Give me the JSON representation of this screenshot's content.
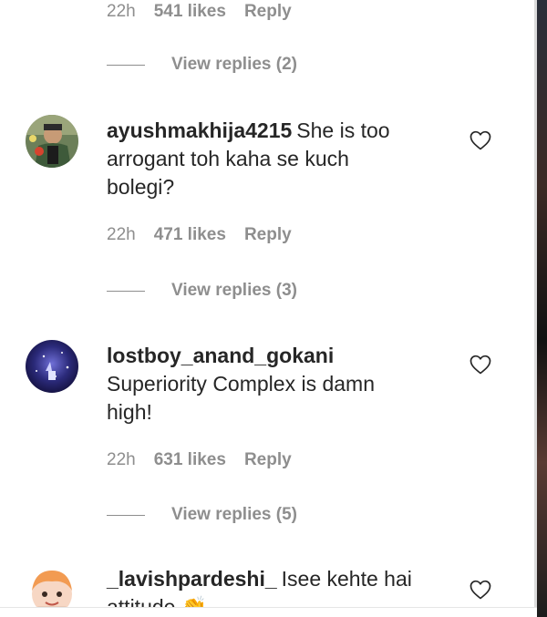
{
  "top_comment": {
    "time": "22h",
    "likes": "541 likes",
    "reply_label": "Reply",
    "view_replies": "View replies (2)"
  },
  "comments": [
    {
      "username": "ayushmakhija4215",
      "text": "She is too arrogant toh kaha se kuch bolegi?",
      "time": "22h",
      "likes": "471 likes",
      "reply_label": "Reply",
      "view_replies": "View replies (3)"
    },
    {
      "username": "lostboy_anand_gokani",
      "text": "Superiority Complex is damn high!",
      "time": "22h",
      "likes": "631 likes",
      "reply_label": "Reply",
      "view_replies": "View replies (5)"
    },
    {
      "username": "_lavishpardeshi_",
      "text": "Isee kehte hai attitude",
      "emoji": "👏"
    }
  ],
  "icons": {
    "like": "heart-outline-icon"
  },
  "colors": {
    "text_primary": "#262626",
    "text_secondary": "#8e8e8e"
  }
}
